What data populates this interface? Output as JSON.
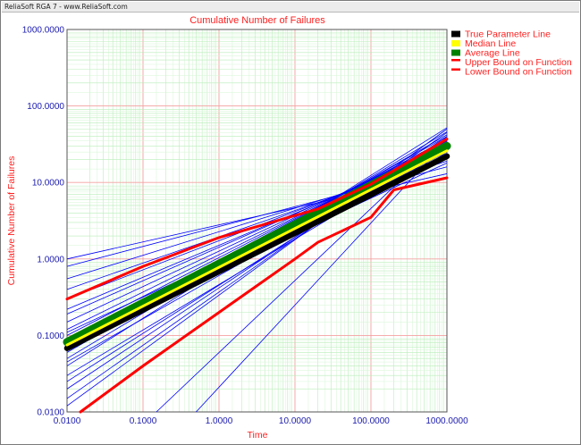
{
  "header": {
    "title": "ReliaSoft RGA 7 - www.ReliaSoft.com"
  },
  "chart_data": {
    "type": "line",
    "title": "Cumulative Number of Failures",
    "xlabel": "Time",
    "ylabel": "Cumulative Number of Failures",
    "x_scale": "log",
    "y_scale": "log",
    "xlim": [
      0.01,
      1000
    ],
    "ylim": [
      0.01,
      1000
    ],
    "x_ticks": [
      "0.0100",
      "0.1000",
      "1.0000",
      "10.0000",
      "100.0000",
      "1000.0000"
    ],
    "y_ticks": [
      "0.0100",
      "0.1000",
      "1.0000",
      "10.0000",
      "100.0000",
      "1000.0000"
    ],
    "grid": true,
    "legend_position": "right",
    "legend": [
      {
        "label": "True Parameter Line",
        "color": "#000000"
      },
      {
        "label": "Median Line",
        "color": "#ffff00"
      },
      {
        "label": "Average Line",
        "color": "#008000"
      },
      {
        "label": "Upper Bound on Function",
        "color": "#ff0000"
      },
      {
        "label": "Lower Bound on Function",
        "color": "#ff0000"
      }
    ],
    "series": [
      {
        "name": "True Parameter Line",
        "color": "#000000",
        "x": [
          0.01,
          1000
        ],
        "y": [
          0.068,
          22.0
        ]
      },
      {
        "name": "Median Line",
        "color": "#ffff00",
        "x": [
          0.01,
          1000
        ],
        "y": [
          0.075,
          26.0
        ]
      },
      {
        "name": "Average Line",
        "color": "#008000",
        "x": [
          0.01,
          1000
        ],
        "y": [
          0.082,
          30.0
        ]
      },
      {
        "name": "Upper Bound on Function",
        "color": "#ff0000",
        "x": [
          0.01,
          0.1,
          1,
          10,
          20,
          100,
          1000
        ],
        "y": [
          0.3,
          0.8,
          1.9,
          3.7,
          4.5,
          9.5,
          37.0
        ]
      },
      {
        "name": "Lower Bound on Function",
        "color": "#ff0000",
        "x": [
          0.015,
          0.1,
          1,
          10,
          20,
          100,
          200,
          1000
        ],
        "y": [
          0.01,
          0.04,
          0.2,
          1.0,
          1.65,
          3.5,
          8.0,
          11.5
        ]
      }
    ],
    "simulation_lines": {
      "color": "#0000ff",
      "lines": [
        [
          0.01,
          1.0,
          1000,
          13.0
        ],
        [
          0.01,
          0.8,
          1000,
          16.0
        ],
        [
          0.01,
          0.55,
          1000,
          19.0
        ],
        [
          0.01,
          0.4,
          1000,
          21.0
        ],
        [
          0.01,
          0.3,
          1000,
          24.0
        ],
        [
          0.01,
          0.22,
          1000,
          27.0
        ],
        [
          0.01,
          0.19,
          1000,
          29.0
        ],
        [
          0.01,
          0.15,
          1000,
          31.0
        ],
        [
          0.01,
          0.12,
          1000,
          33.0
        ],
        [
          0.01,
          0.1,
          1000,
          35.0
        ],
        [
          0.01,
          0.085,
          1000,
          37.0
        ],
        [
          0.01,
          0.07,
          1000,
          40.0
        ],
        [
          0.01,
          0.06,
          1000,
          42.0
        ],
        [
          0.01,
          0.05,
          1000,
          46.0
        ],
        [
          0.01,
          0.04,
          1000,
          52.0
        ],
        [
          0.01,
          0.03,
          1000,
          28.0
        ],
        [
          0.01,
          0.025,
          1000,
          35.0
        ],
        [
          0.01,
          0.02,
          1000,
          40.0
        ],
        [
          0.01,
          0.015,
          1000,
          45.0
        ],
        [
          0.01,
          0.012,
          1000,
          50.0
        ],
        [
          0.15,
          0.01,
          1000,
          40.0
        ],
        [
          0.5,
          0.01,
          1000,
          35.0
        ],
        [
          0.01,
          0.09,
          1000,
          18.0
        ],
        [
          0.01,
          0.11,
          1000,
          22.0
        ],
        [
          0.01,
          0.065,
          1000,
          25.0
        ],
        [
          0.01,
          0.045,
          1000,
          30.0
        ]
      ]
    }
  }
}
